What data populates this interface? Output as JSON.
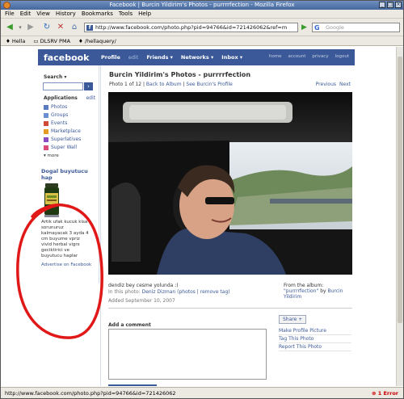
{
  "window": {
    "title": "Facebook | Burcin Yildirim's Photos - purrrrfection - Mozilla Firefox"
  },
  "menu": [
    "File",
    "Edit",
    "View",
    "History",
    "Bookmarks",
    "Tools",
    "Help"
  ],
  "toolbar": {
    "url": "http://www.facebook.com/photo.php?pid=94766&id=721426062&ref=m",
    "search_placeholder": "Google"
  },
  "bookmarks": [
    "Hella",
    "DLSRV PMA",
    "/hellaquery/"
  ],
  "facebook": {
    "logo": "facebook",
    "nav": [
      "Profile",
      "edit",
      "Friends ▾",
      "Networks ▾",
      "Inbox ▾"
    ],
    "right_links": [
      "home",
      "account",
      "privacy",
      "logout"
    ]
  },
  "sidebar": {
    "search_label": "Search ▾",
    "applications_label": "Applications",
    "edit_label": "edit",
    "apps": [
      {
        "label": "Photos",
        "color": "#5a7bbf"
      },
      {
        "label": "Groups",
        "color": "#6b8ed0"
      },
      {
        "label": "Events",
        "color": "#d04a3a"
      },
      {
        "label": "Marketplace",
        "color": "#e59a23"
      },
      {
        "label": "Superlatives",
        "color": "#8a4cc2"
      },
      {
        "label": "Super Wall",
        "color": "#d94b7a"
      }
    ],
    "more_label": "▾ more"
  },
  "ad": {
    "title": "Dogal buyutucu hap",
    "text": "Artik ufak kucuk kisa sorunuruz kalmayacak 3 ayda 4 cm buyume vpriz vivid herbal vigrx geciktirici ve buyutucu haplar",
    "footer": "Advertise on Facebook"
  },
  "photo_page": {
    "title": "Burcin Yildirim's Photos - purrrrfection",
    "counter": "Photo 1 of 12",
    "back_link": "Back to Album",
    "profile_link": "See Burcin's Profile",
    "previous": "Previous",
    "next": "Next",
    "caption": "dendiz bey cesme yolunda :)",
    "in_photo_label": "In this photo:",
    "tagged_name": "Deniz Dizman",
    "tag_links": "(photos | remove tag)",
    "album_label": "From the album:",
    "album_name": "\"purrrrfection\"",
    "album_by": "by",
    "album_owner": "Burcin Yildirim",
    "added": "Added September 10, 2007",
    "add_comment": "Add a comment",
    "share": "Share",
    "actions": [
      "Make Profile Picture",
      "Tag This Photo",
      "Report This Photo"
    ]
  },
  "status": {
    "url": "http://www.facebook.com/photo.php?pid=94766&id=721426062",
    "errors": "1 Error"
  }
}
